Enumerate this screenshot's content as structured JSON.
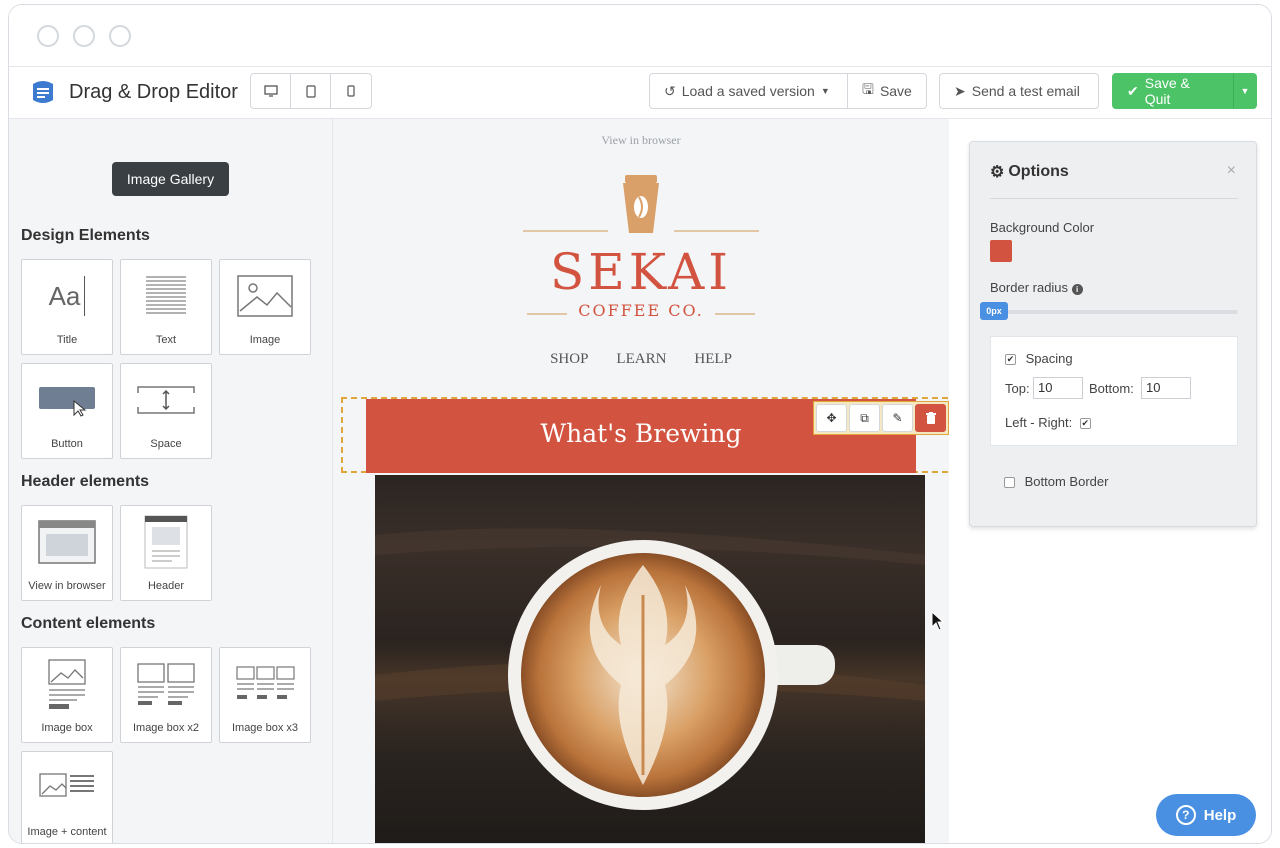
{
  "toolbar": {
    "title": "Drag & Drop Editor",
    "load_label": "Load a saved version",
    "save_label": "Save",
    "test_email_label": "Send a test email",
    "save_quit_label": "Save & Quit"
  },
  "sidebar": {
    "gallery_label": "Image Gallery",
    "design_title": "Design Elements",
    "design_items": [
      "Title",
      "Text",
      "Image",
      "Button",
      "Space"
    ],
    "header_title": "Header elements",
    "header_items": [
      "View in browser",
      "Header"
    ],
    "content_title": "Content elements",
    "content_items": [
      "Image box",
      "Image box x2",
      "Image box x3",
      "Image + content"
    ]
  },
  "canvas": {
    "view_in_browser": "View in browser",
    "brand_name": "SEKAI",
    "brand_sub": "COFFEE CO.",
    "nav": [
      "SHOP",
      "LEARN",
      "HELP"
    ],
    "banner_title": "What's Brewing"
  },
  "options": {
    "title": "Options",
    "close": "×",
    "bg_color_label": "Background Color",
    "bg_color": "#d2533f",
    "border_radius_label": "Border radius",
    "border_radius_value": "0px",
    "spacing_label": "Spacing",
    "top_label": "Top:",
    "top_value": "10",
    "bottom_label": "Bottom:",
    "bottom_value": "10",
    "left_right_label": "Left - Right:",
    "bottom_border_label": "Bottom Border"
  },
  "help": {
    "label": "Help"
  },
  "colors": {
    "accent": "#d2533f",
    "green": "#4cc366",
    "blue": "#4a90e2"
  }
}
